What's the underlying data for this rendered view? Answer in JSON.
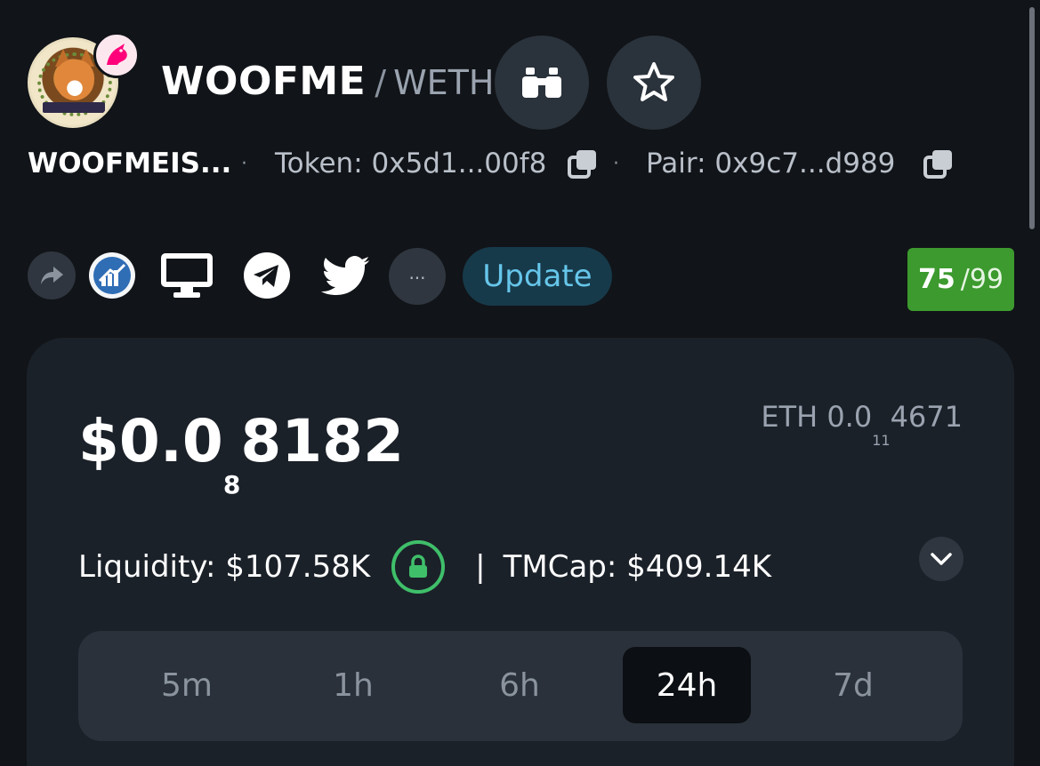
{
  "pair": {
    "base_symbol": "WOOFME",
    "separator": "/",
    "quote_symbol": "WETH",
    "token_name": "WOOFMEIS...",
    "token_label": "Token:",
    "token_address": "0x5d1...00f8",
    "pair_label": "Pair:",
    "pair_address": "0x9c7...d989",
    "bullet": "·",
    "logo_text": "WOOFMEISTER"
  },
  "icons": {
    "logo": "woofmeister-logo",
    "dex": "uniswap-unicorn-icon",
    "binoculars": "binoculars-icon",
    "star": "star-icon",
    "copy": "copy-icon",
    "share": "share-icon",
    "coingecko": "chart-badge-icon",
    "website": "monitor-icon",
    "telegram": "telegram-icon",
    "twitter": "twitter-icon",
    "lock": "lock-icon",
    "chevron": "chevron-down-icon"
  },
  "actions": {
    "more_label": "...",
    "update_label": "Update"
  },
  "score": {
    "value": "75",
    "max": "/99"
  },
  "price": {
    "usd_prefix": "$0.0",
    "usd_zero_count": "8",
    "usd_digits": "8182",
    "eth_prefix": "ETH 0.0",
    "eth_zero_count": "11",
    "eth_digits": "4671"
  },
  "stats": {
    "liquidity_label": "Liquidity:",
    "liquidity_value": "$107.58K",
    "divider": "|",
    "tmcap_label": "TMCap:",
    "tmcap_value": "$409.14K"
  },
  "timeframes": {
    "tabs": [
      "5m",
      "1h",
      "6h",
      "24h",
      "7d"
    ],
    "active": "24h"
  },
  "colors": {
    "background": "#111418",
    "card": "#1b2129",
    "score_green": "#3c9a2e",
    "update_text": "#66c6ea",
    "lock_green": "#3fbf6a"
  }
}
